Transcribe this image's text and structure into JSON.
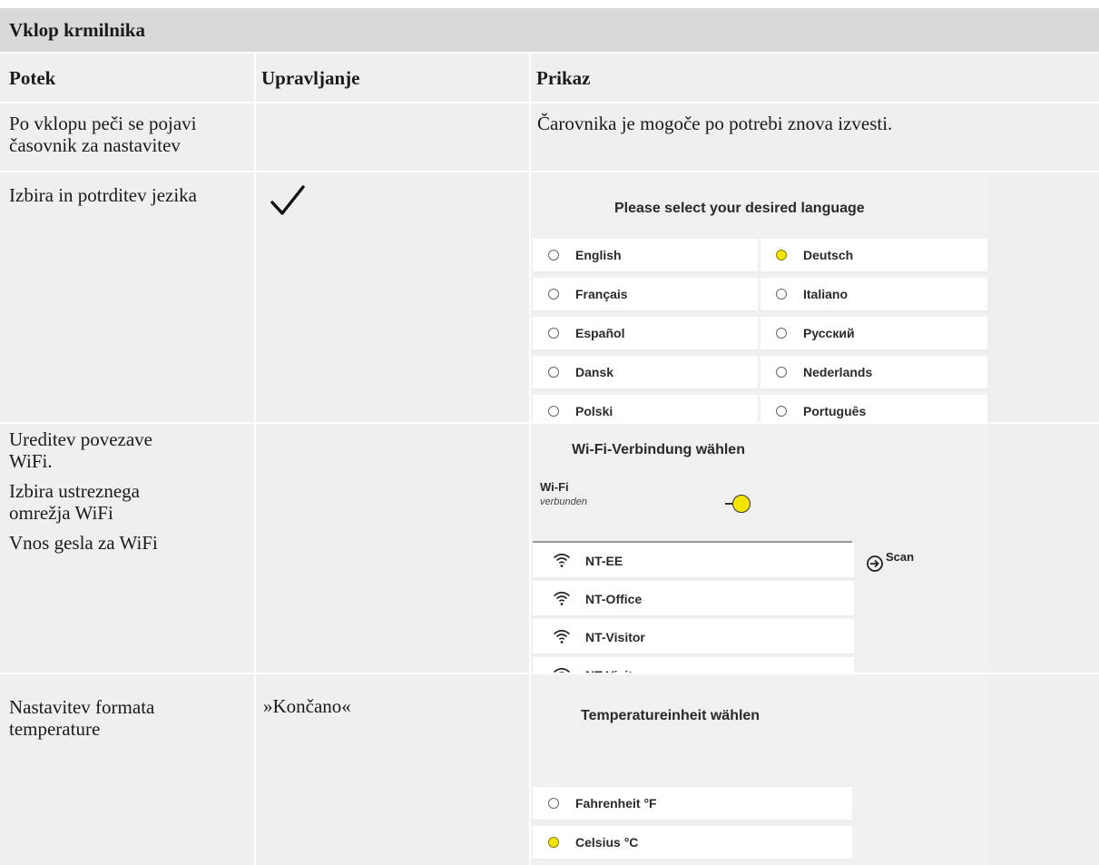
{
  "section_title": "Vklop krmilnika",
  "columns": [
    "Potek",
    "Upravljanje",
    "Prikaz"
  ],
  "rows": [
    {
      "potek": [
        "Po vklopu peči se pojavi",
        "časovnik za nastavitev"
      ],
      "upravljanje": "",
      "prikaz_text": "Čarovnika je mogoče po potrebi znova izvesti."
    },
    {
      "potek": [
        "Izbira in potrditev jezika"
      ],
      "upravljanje_icon": "checkmark-icon",
      "screen": {
        "title": "Please select your desired language",
        "options": [
          {
            "label": "English",
            "selected": false
          },
          {
            "label": "Deutsch",
            "selected": true
          },
          {
            "label": "Français",
            "selected": false
          },
          {
            "label": "Italiano",
            "selected": false
          },
          {
            "label": "Español",
            "selected": false
          },
          {
            "label": "Русский",
            "selected": false
          },
          {
            "label": "Dansk",
            "selected": false
          },
          {
            "label": "Nederlands",
            "selected": false
          },
          {
            "label": "Polski",
            "selected": false
          },
          {
            "label": "Português",
            "selected": false
          }
        ]
      }
    },
    {
      "potek": [
        "Ureditev povezave",
        "WiFi.",
        "Izbira ustreznega",
        "omrežja WiFi",
        "Vnos gesla za WiFi"
      ],
      "upravljanje": "",
      "screen": {
        "title": "Wi-Fi-Verbindung wählen",
        "wifi_label": "Wi-Fi",
        "wifi_status": "verbunden",
        "wifi_toggle_on": true,
        "scan_label": "Scan",
        "networks": [
          "NT-EE",
          "NT-Office",
          "NT-Visitor",
          "NT-Visitor"
        ]
      }
    },
    {
      "potek": [
        "Nastavitev formata",
        "temperature"
      ],
      "upravljanje": "»Končano«",
      "screen": {
        "title": "Temperatureinheit wählen",
        "options": [
          {
            "label": "Fahrenheit °F",
            "selected": false
          },
          {
            "label": "Celsius °C",
            "selected": true
          }
        ]
      }
    }
  ],
  "colors": {
    "header_bg": "#d9d9d9",
    "row_bg": "#efefef",
    "accent_yellow": "#f5e400"
  }
}
